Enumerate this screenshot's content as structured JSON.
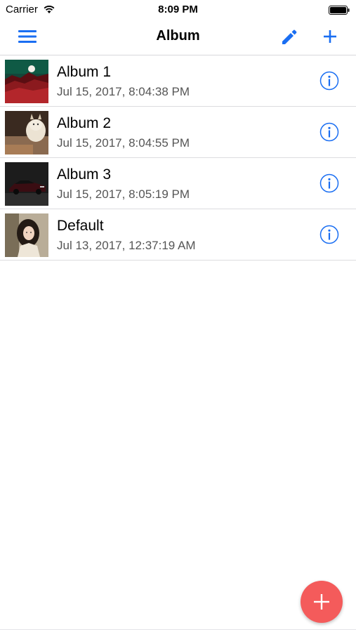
{
  "status_bar": {
    "carrier": "Carrier",
    "time": "8:09 PM"
  },
  "nav": {
    "title": "Album",
    "left_icon": "hamburger-menu-icon",
    "right_icons": [
      "pencil-icon",
      "plus-icon"
    ]
  },
  "albums": [
    {
      "name": "Album 1",
      "date": "Jul 15, 2017, 8:04:38 PM",
      "thumbnail": "landscape-sunset"
    },
    {
      "name": "Album 2",
      "date": "Jul 15, 2017, 8:04:55 PM",
      "thumbnail": "cat"
    },
    {
      "name": "Album 3",
      "date": "Jul 15, 2017, 8:05:19 PM",
      "thumbnail": "dark-car"
    },
    {
      "name": "Default",
      "date": "Jul 13, 2017, 12:37:19 AM",
      "thumbnail": "portrait"
    }
  ],
  "fab": {
    "icon": "plus-icon"
  },
  "colors": {
    "accent": "#1a6ef2",
    "fab": "#f45b5b",
    "separator": "#dcdcdf"
  }
}
